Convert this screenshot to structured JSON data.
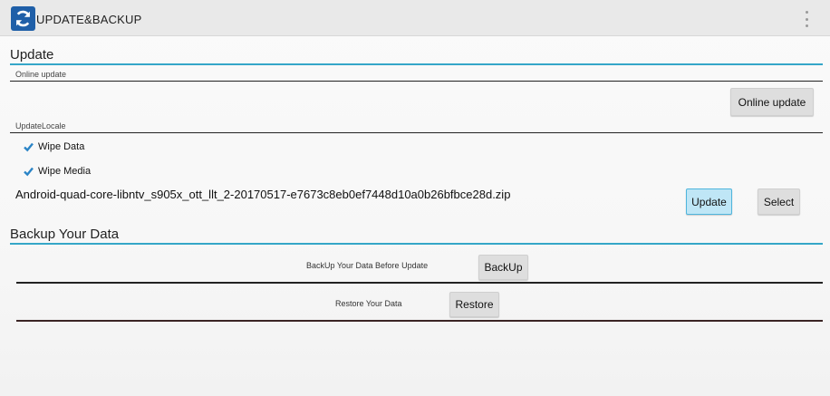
{
  "app": {
    "title": "UPDATE&BACKUP",
    "icon": "sync-icon",
    "accent_color": "#1f5fa8",
    "menu_icon": "overflow-menu-icon"
  },
  "update": {
    "section_title": "Update",
    "online_update_label": "Online update",
    "online_update_button": "Online update",
    "local_label": "UpdateLocale",
    "wipe_data": {
      "label": "Wipe Data",
      "checked": true
    },
    "wipe_media": {
      "label": "Wipe Media",
      "checked": true
    },
    "filename": "Android-quad-core-libntv_s905x_ott_llt_2-20170517-e7673c8eb0ef7448d10a0b26bfbce28d.zip",
    "update_button": "Update",
    "select_button": "Select"
  },
  "backup": {
    "section_title": "Backup Your Data",
    "backup_label": "BackUp Your Data Before Update",
    "backup_button": "BackUp",
    "restore_label": "Restore Your Data",
    "restore_button": "Restore"
  },
  "colors": {
    "section_rule": "#35a6c8",
    "focused_button_bg": "#bfe6f6",
    "checkbox": "#2a84c6"
  }
}
